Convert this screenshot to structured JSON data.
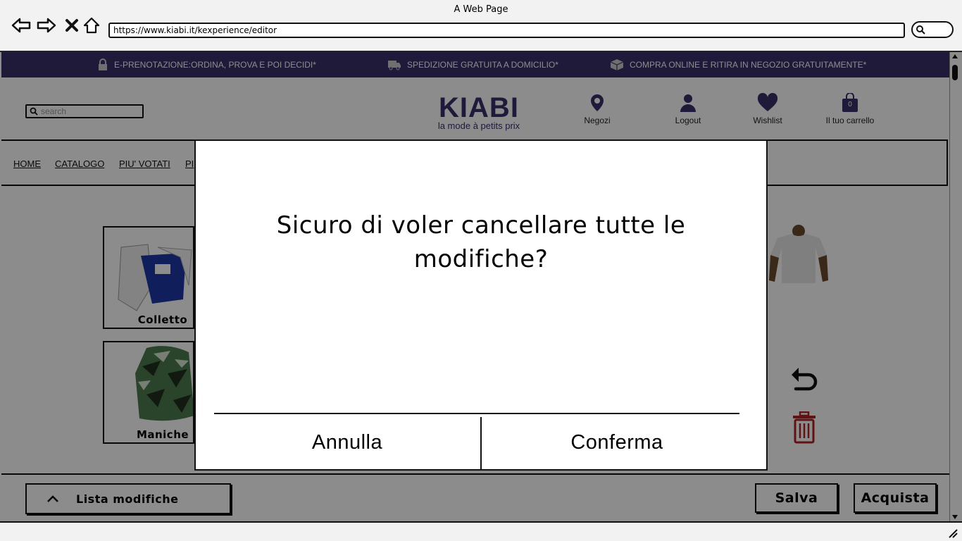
{
  "browser": {
    "title": "A Web Page",
    "url": "https://www.kiabi.it/kexperience/editor"
  },
  "promo": [
    {
      "icon": "lock-icon",
      "text": "E-PRENOTAZIONE:ORDINA, PROVA E POI DECIDI*"
    },
    {
      "icon": "truck-icon",
      "text": "SPEDIZIONE GRATUITA A DOMICILIO*"
    },
    {
      "icon": "box-icon",
      "text": "COMPRA ONLINE E RITIRA IN NEGOZIO GRATUITAMENTE*"
    }
  ],
  "header": {
    "search_placeholder": "search",
    "logo_main": "KIABI",
    "logo_sub": "la mode à petits prix",
    "icons": [
      {
        "icon": "location-pin-icon",
        "label": "Negozi"
      },
      {
        "icon": "user-icon",
        "label": "Logout"
      },
      {
        "icon": "heart-icon",
        "label": "Wishlist"
      },
      {
        "icon": "shopping-bag-icon",
        "label": "Il tuo carrello",
        "badge": "0"
      }
    ]
  },
  "nav": {
    "links": [
      "HOME",
      "CATALOGO",
      "PIU' VOTATI",
      "PI"
    ]
  },
  "editor": {
    "parts": [
      "Colletto",
      "Maniche"
    ]
  },
  "bottom_bar": {
    "list_label": "Lista modifiche",
    "save_label": "Salva",
    "buy_label": "Acquista"
  },
  "modal": {
    "message": "Sicuro di voler cancellare tutte le modifiche?",
    "cancel_label": "Annulla",
    "confirm_label": "Conferma"
  },
  "colors": {
    "brand": "#3a2f6b",
    "trash": "#b22222"
  }
}
